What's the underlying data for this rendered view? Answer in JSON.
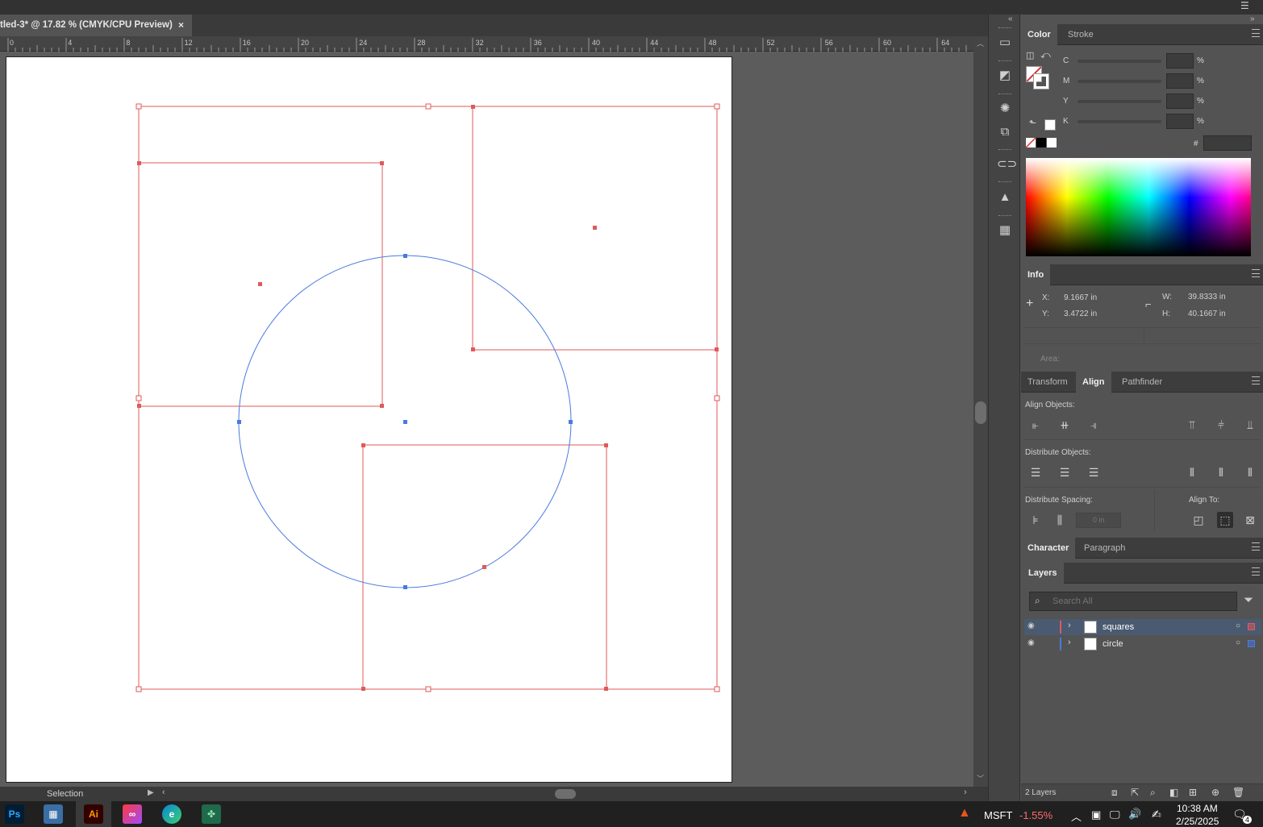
{
  "document": {
    "tab_title": "tled-3* @ 17.82 % (CMYK/CPU Preview)",
    "close_glyph": "×"
  },
  "ruler": {
    "ticks": [
      "0",
      "4",
      "8",
      "12",
      "16",
      "20",
      "24",
      "28",
      "32",
      "36",
      "40",
      "44",
      "48",
      "52",
      "56",
      "60",
      "64"
    ]
  },
  "status": {
    "tool_name": "Selection"
  },
  "colors": {
    "red_layer": "#e05a5a",
    "blue_layer": "#4a7ae0"
  },
  "color_panel": {
    "tabs": [
      "Color",
      "Stroke"
    ],
    "channels": [
      "C",
      "M",
      "Y",
      "K"
    ],
    "percent": "%",
    "hex_label": "#"
  },
  "info_panel": {
    "tab": "Info",
    "x_label": "X:",
    "x_value": "9.1667 in",
    "y_label": "Y:",
    "y_value": "3.4722 in",
    "w_label": "W:",
    "w_value": "39.8333 in",
    "h_label": "H:",
    "h_value": "40.1667 in",
    "area_label": "Area:"
  },
  "align_panel": {
    "tabs": [
      "Transform",
      "Align",
      "Pathfinder"
    ],
    "align_objects": "Align Objects:",
    "distribute_objects": "Distribute Objects:",
    "distribute_spacing": "Distribute Spacing:",
    "align_to": "Align To:",
    "spacing_value": "0 in"
  },
  "character_panel": {
    "tabs": [
      "Character",
      "Paragraph"
    ]
  },
  "layers_panel": {
    "tab": "Layers",
    "search_placeholder": "Search All",
    "layers": [
      {
        "name": "squares",
        "color": "#e05a5a"
      },
      {
        "name": "circle",
        "color": "#4a7ae0"
      }
    ],
    "count": "2 Layers"
  },
  "taskbar": {
    "apps": [
      "Ps",
      "Ai"
    ],
    "stock_symbol": "MSFT",
    "stock_change": "-1.55%",
    "time": "10:38 AM",
    "date": "2/25/2025",
    "notification_count": "4"
  }
}
